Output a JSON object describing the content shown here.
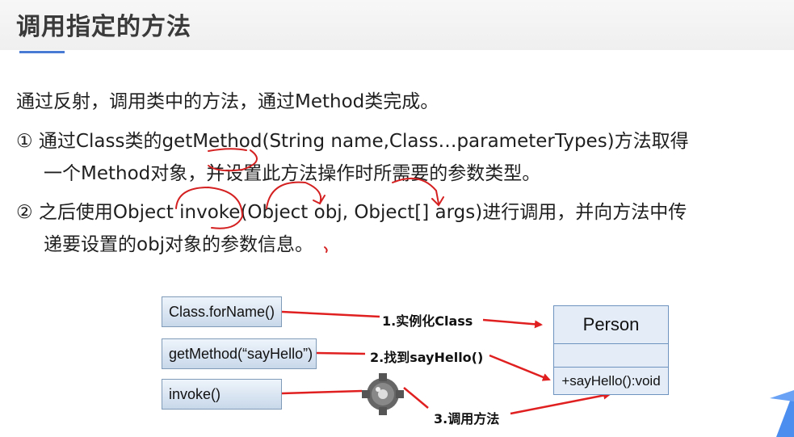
{
  "title": "调用指定的方法",
  "intro": "通过反射，调用类中的方法，通过Method类完成。",
  "step1": {
    "line1": "① 通过Class类的getMethod(String name,Class…parameterTypes)方法取得",
    "line2": "一个Method对象，并设置此方法操作时所需要的参数类型。"
  },
  "step2": {
    "line1": "② 之后使用Object invoke(Object obj, Object[] args)进行调用，并向方法中传",
    "line2": "递要设置的obj对象的参数信息。"
  },
  "diagram": {
    "box_forname": "Class.forName()",
    "box_getmethod": "getMethod(“sayHello”)",
    "box_invoke": "invoke()",
    "label1": "1.实例化Class",
    "label2": "2.找到sayHello()",
    "label3": "3.调用方法",
    "class_name": "Person",
    "class_attrs": "",
    "class_method": "+sayHello():void"
  },
  "colors": {
    "accent": "#4a7bd4",
    "arrow": "#e02020",
    "annotation": "#d42020",
    "corner": "#4c8df0"
  }
}
